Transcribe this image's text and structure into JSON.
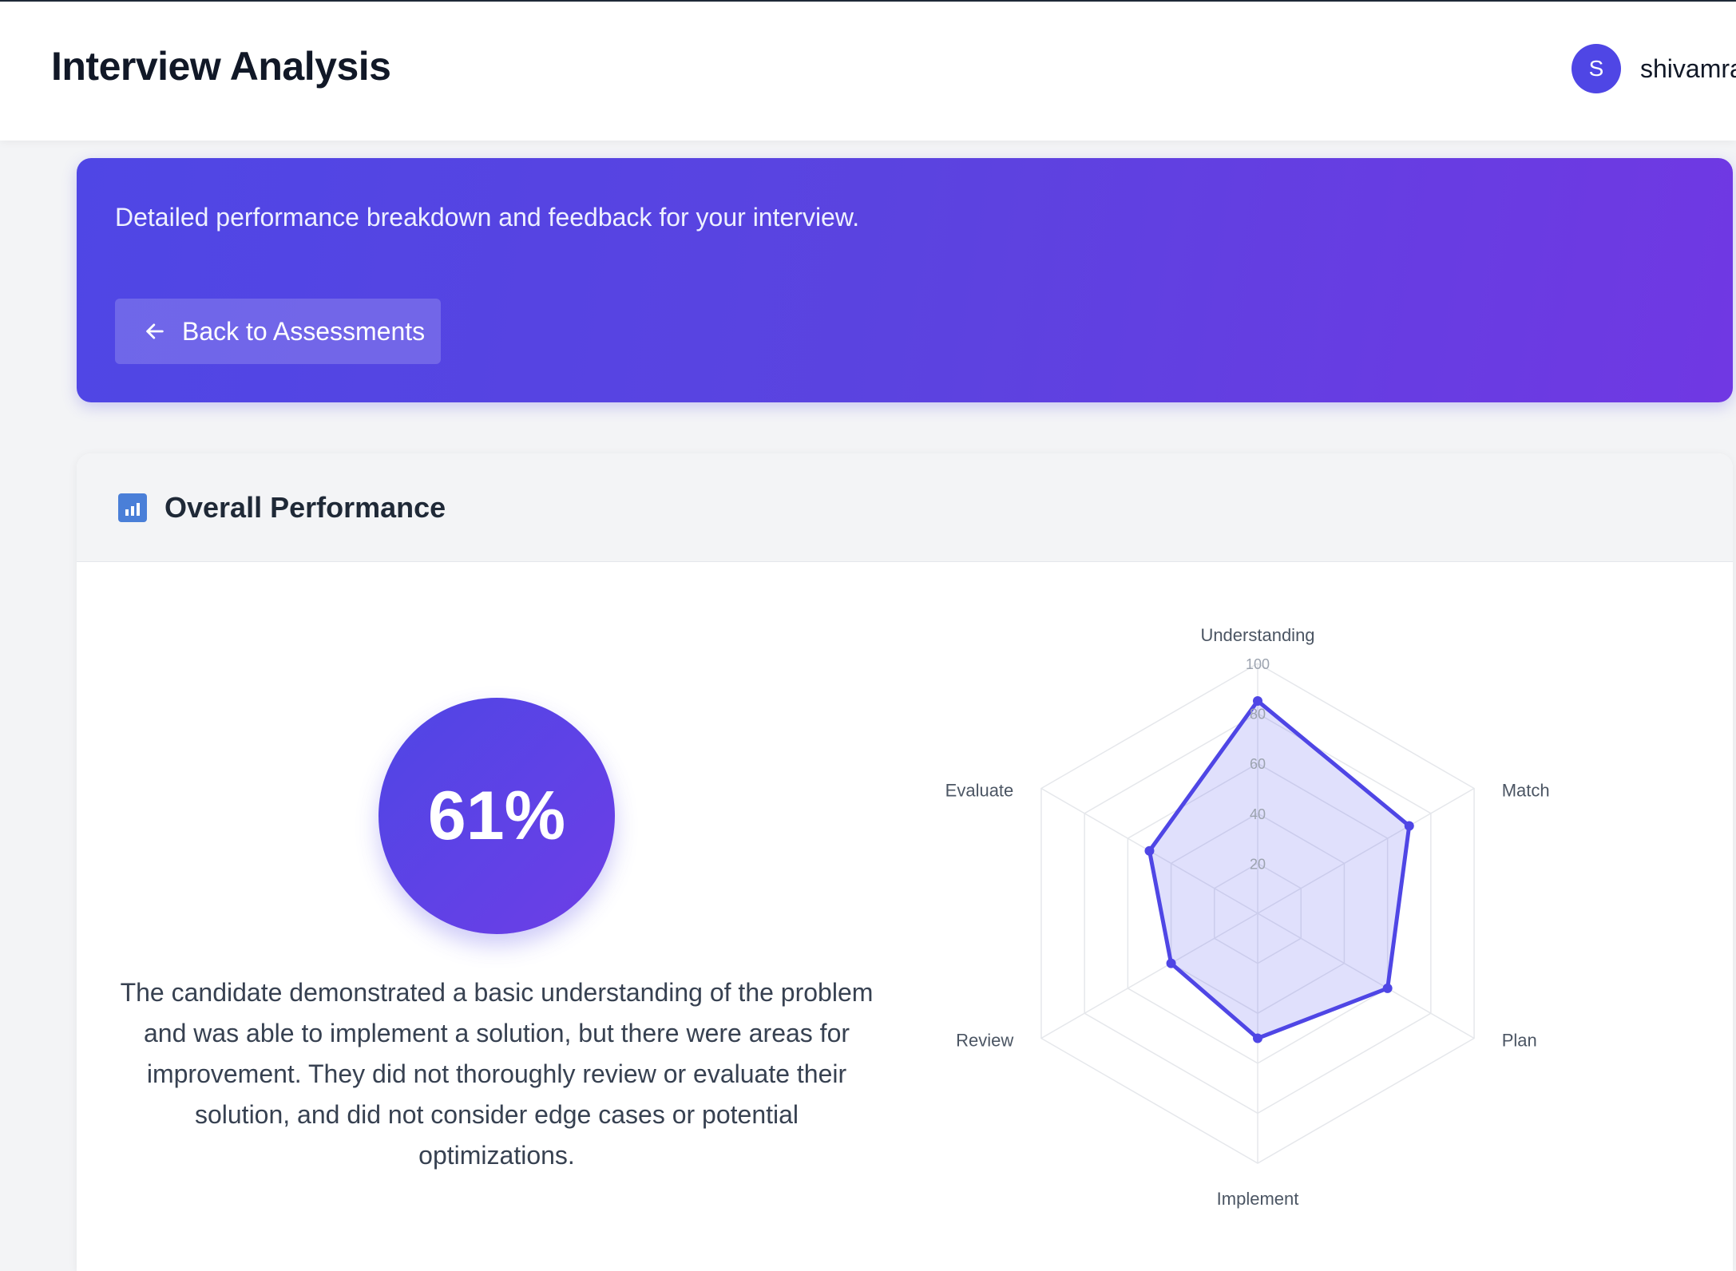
{
  "header": {
    "title": "Interview Analysis",
    "avatar_initial": "S",
    "username": "shivamra"
  },
  "hero": {
    "subtitle": "Detailed performance breakdown and feedback for your interview.",
    "back_label": "Back to Assessments"
  },
  "performance": {
    "title": "Overall Performance",
    "score": "61%",
    "summary": "The candidate demonstrated a basic understanding of the problem and was able to implement a solution, but there were areas for improvement. They did not thoroughly review or evaluate their solution, and did not consider edge cases or potential optimizations."
  },
  "chart_data": {
    "type": "radar",
    "categories": [
      "Understanding",
      "Match",
      "Plan",
      "Implement",
      "Review",
      "Evaluate"
    ],
    "values": [
      85,
      70,
      60,
      50,
      40,
      50
    ],
    "r_ticks": [
      20,
      40,
      60,
      80,
      100
    ],
    "rlim": [
      0,
      100
    ],
    "colors": {
      "line": "#4f46e5",
      "fill": "#6366f1",
      "grid": "#e5e7eb"
    }
  }
}
